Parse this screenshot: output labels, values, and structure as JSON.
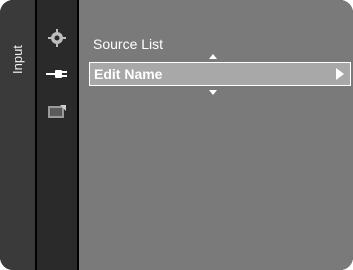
{
  "tab": {
    "label": "Input"
  },
  "sidebar": {
    "icons": [
      {
        "name": "picture-settings-icon"
      },
      {
        "name": "input-plug-icon"
      },
      {
        "name": "media-card-icon"
      }
    ]
  },
  "menu": {
    "items": [
      {
        "label": "Source List",
        "selected": false
      },
      {
        "label": "Edit Name",
        "selected": true
      }
    ]
  },
  "colors": {
    "menu_background": "#7a7a7a",
    "selected_background": "#a8a8a8",
    "sidebar_background": "#2a2a2a",
    "text": "#ffffff"
  }
}
